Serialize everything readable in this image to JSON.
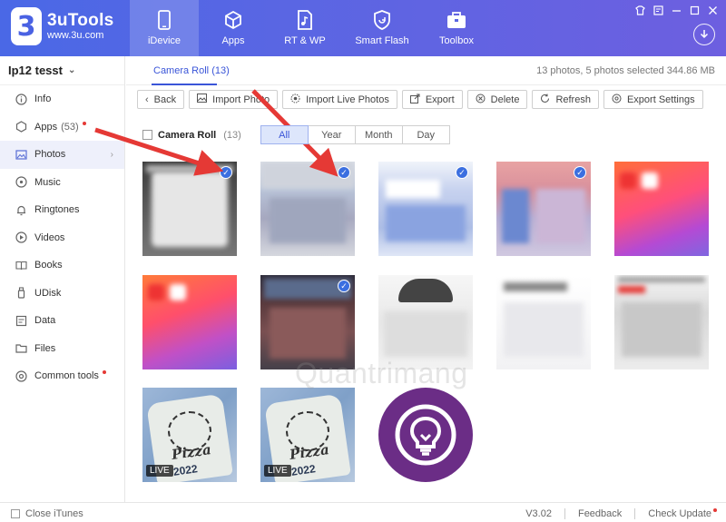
{
  "app": {
    "logo_badge": "3",
    "logo_name": "3uTools",
    "logo_url": "www.3u.com"
  },
  "nav": [
    {
      "label": "iDevice",
      "icon": "phone-icon"
    },
    {
      "label": "Apps",
      "icon": "cube-icon"
    },
    {
      "label": "RT & WP",
      "icon": "music-file-icon"
    },
    {
      "label": "Smart Flash",
      "icon": "flash-icon"
    },
    {
      "label": "Toolbox",
      "icon": "toolbox-icon"
    }
  ],
  "window_controls": [
    "skin-icon",
    "feedback-icon",
    "minimize-icon",
    "restore-icon",
    "close-icon"
  ],
  "sidebar": {
    "device_name": "Ip12 tesst",
    "items": [
      {
        "label": "Info",
        "icon": "info-icon",
        "count": "",
        "dot": false
      },
      {
        "label": "Apps",
        "icon": "apps-icon",
        "count": "(53)",
        "dot": true
      },
      {
        "label": "Photos",
        "icon": "photos-icon",
        "count": "",
        "dot": false,
        "active": true
      },
      {
        "label": "Music",
        "icon": "music-icon",
        "count": "",
        "dot": false
      },
      {
        "label": "Ringtones",
        "icon": "bell-icon",
        "count": "",
        "dot": false
      },
      {
        "label": "Videos",
        "icon": "video-icon",
        "count": "",
        "dot": false
      },
      {
        "label": "Books",
        "icon": "book-icon",
        "count": "",
        "dot": false
      },
      {
        "label": "UDisk",
        "icon": "udisk-icon",
        "count": "",
        "dot": false
      },
      {
        "label": "Data",
        "icon": "data-icon",
        "count": "",
        "dot": false
      },
      {
        "label": "Files",
        "icon": "folder-icon",
        "count": "",
        "dot": false
      },
      {
        "label": "Common tools",
        "icon": "tools-icon",
        "count": "",
        "dot": true
      }
    ]
  },
  "main": {
    "tab_label": "Camera Roll",
    "tab_count": "(13)",
    "photo_info": "13 photos, 5 photos selected 344.86 MB"
  },
  "toolbar": {
    "back": "Back",
    "import_photo": "Import Photo",
    "import_live": "Import Live Photos",
    "export": "Export",
    "delete": "Delete",
    "refresh": "Refresh",
    "export_settings": "Export Settings"
  },
  "filter": {
    "album": "Camera Roll",
    "count": "(13)",
    "segments": [
      "All",
      "Year",
      "Month",
      "Day"
    ],
    "active_segment": "All"
  },
  "photos": [
    {
      "selected": true
    },
    {
      "selected": true
    },
    {
      "selected": true
    },
    {
      "selected": true
    },
    {
      "selected": false
    },
    {
      "selected": false
    },
    {
      "selected": true
    },
    {
      "selected": false
    },
    {
      "selected": false
    },
    {
      "selected": false
    },
    {
      "selected": false,
      "badge": "LIVE",
      "text": "Pizza",
      "year": "2022"
    },
    {
      "selected": false,
      "badge": "LIVE",
      "text": "Pizza",
      "year": "2022"
    },
    {
      "selected": false
    }
  ],
  "watermark": "Quantrimang",
  "footer": {
    "close_itunes": "Close iTunes",
    "version": "V3.02",
    "feedback": "Feedback",
    "check_update": "Check Update"
  },
  "colors": {
    "header_start": "#4a68e6",
    "header_end": "#6d5fe0",
    "accent": "#3a55d8",
    "selected_check": "#3b6fe0",
    "arrow": "#e53935"
  }
}
